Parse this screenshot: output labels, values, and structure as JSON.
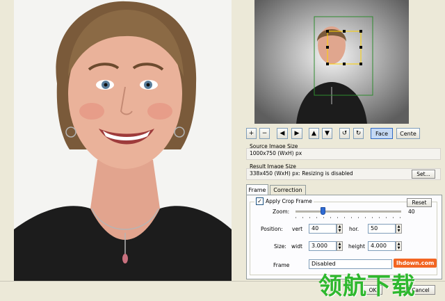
{
  "toolbar": {
    "zoom_in": "+",
    "zoom_out": "−",
    "left": "◀",
    "right": "▶",
    "up": "▲",
    "down": "▼",
    "rotate_ccw": "↺",
    "rotate_cw": "↻",
    "face": "Face",
    "center": "Cente"
  },
  "source": {
    "label": "Source Image Size",
    "value": "1000x750 (WxH) px"
  },
  "result": {
    "label": "Result Image Size",
    "value": "338x450 (WxH) px: Resizing is disabled",
    "set_label": "Set..."
  },
  "tabs": [
    "Frame",
    "Correction"
  ],
  "frame": {
    "apply_label": "Apply Crop Frame",
    "apply_checked": true,
    "reset_label": "Reset",
    "zoom_label": "Zoom:",
    "zoom_value": "40",
    "position_label": "Position:",
    "vert_label": "vert",
    "vert_value": "40",
    "hor_label": "hor.",
    "hor_value": "50",
    "size_label": "Size:",
    "width_label": "widt",
    "width_value": "3.000",
    "height_label": "height",
    "height_value": "4.000",
    "frame_label": "Frame",
    "frame_select": "Disabled"
  },
  "footer": {
    "ok": "OK",
    "cancel": "Cancel"
  },
  "watermark": {
    "domain": "lhdown.com",
    "chinese": "领航下载"
  }
}
